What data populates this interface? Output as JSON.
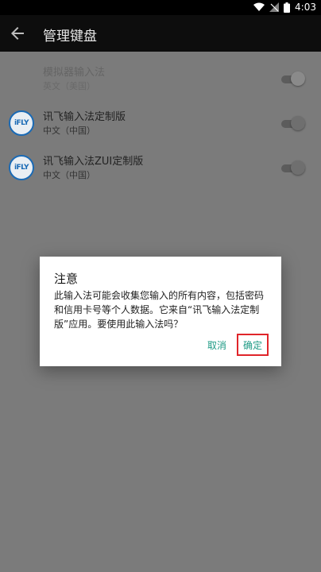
{
  "status_bar": {
    "time": "4:03"
  },
  "toolbar": {
    "title": "管理键盘"
  },
  "keyboards": [
    {
      "name": "模拟器输入法",
      "locale": "英文（美国）",
      "enabled": true
    },
    {
      "name": "讯飞输入法定制版",
      "locale": "中文（中国）",
      "enabled": false,
      "logo": "iFLY"
    },
    {
      "name": "讯飞输入法ZUI定制版",
      "locale": "中文（中国）",
      "enabled": false,
      "logo": "iFLY"
    }
  ],
  "dialog": {
    "title": "注意",
    "message": "此输入法可能会收集您输入的所有内容，包括密码和信用卡号等个人数据。它来自“讯飞输入法定制版”应用。要使用此输入法吗？",
    "cancel_label": "取消",
    "ok_label": "确定"
  },
  "colors": {
    "accent": "#1d9a84",
    "highlight": "#e0252a",
    "toolbar": "#0d0d0d"
  }
}
